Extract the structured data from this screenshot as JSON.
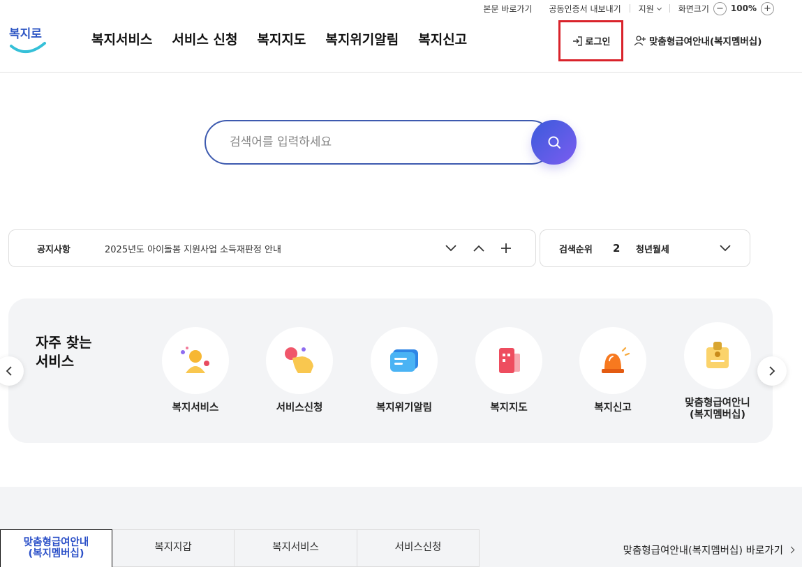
{
  "utility": {
    "skip_link": "본문 바로가기",
    "cert_export": "공동인증서 내보내기",
    "support": "지원",
    "zoom_label": "화면크기",
    "zoom_value": "100%",
    "zoom_minus": "−",
    "zoom_plus": "+"
  },
  "header": {
    "logo_text": "복지로",
    "nav": [
      "복지서비스",
      "서비스 신청",
      "복지지도",
      "복지위기알림",
      "복지신고"
    ],
    "login": "로그인",
    "member_info": "맞춤형급여안내(복지멤버십)"
  },
  "search": {
    "placeholder": "검색어를 입력하세요"
  },
  "notice": {
    "title": "공지사항",
    "text": "2025년도 아이돌봄 지원사업 소득재판정 안내"
  },
  "ranking": {
    "title": "검색순위",
    "rank": "2",
    "keyword": "청년월세"
  },
  "frequent": {
    "title_line1": "자주 찾는",
    "title_line2": "서비스",
    "items": [
      {
        "label": "복지서비스",
        "icon": "person-icon"
      },
      {
        "label": "서비스신청",
        "icon": "hand-click-icon"
      },
      {
        "label": "복지위기알림",
        "icon": "message-icon"
      },
      {
        "label": "복지지도",
        "icon": "map-icon"
      },
      {
        "label": "복지신고",
        "icon": "siren-icon"
      },
      {
        "label_line1": "맞춤형급여안니",
        "label_line2": "(복지멤버십)",
        "icon": "id-badge-icon"
      }
    ]
  },
  "bottom": {
    "tabs": [
      {
        "line1": "맞춤형급여안내",
        "line2": "(복지멤버십)",
        "active": true
      },
      {
        "line1": "복지지갑"
      },
      {
        "line1": "복지서비스"
      },
      {
        "line1": "서비스신청"
      }
    ],
    "go_link": "맞춤형급여안내(복지멤버십) 바로가기"
  },
  "colors": {
    "primary": "#3d5aaf",
    "search_gradient_start": "#3b5bdb",
    "search_gradient_end": "#7b5cf0",
    "highlight_red": "#d9232b",
    "active_tab_text": "#2b50c8"
  }
}
